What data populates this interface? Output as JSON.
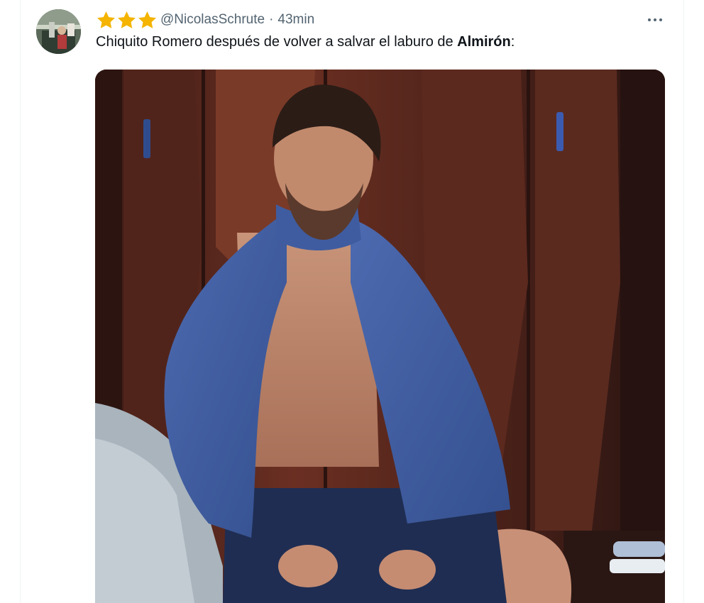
{
  "tweet": {
    "avatar_icon": "avatar-image",
    "stars": [
      "star-icon",
      "star-icon",
      "star-icon"
    ],
    "star_color": "#f4b400",
    "handle": "@NicolasSchrute",
    "separator": "·",
    "time": "43min",
    "more_icon": "more-options-icon",
    "text_normal": "Chiquito Romero después de volver a salvar el laburo de ",
    "text_bold": "Almirón",
    "text_end": ":",
    "media_icon": "photo-image"
  }
}
